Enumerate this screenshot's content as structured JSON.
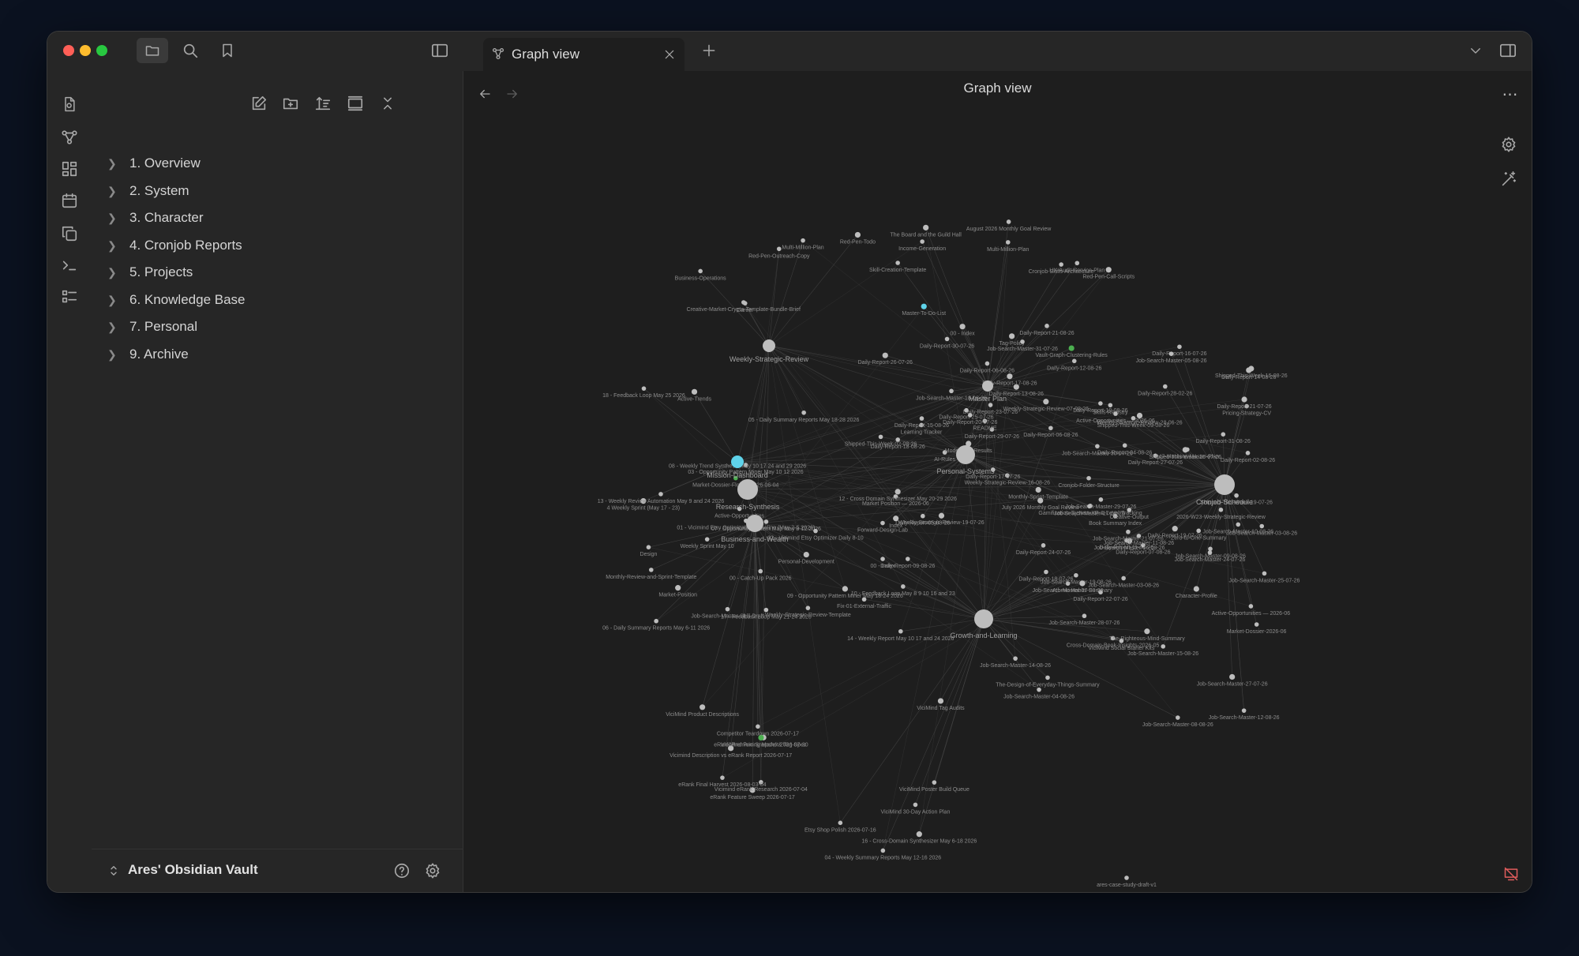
{
  "window": {
    "tab_title": "Graph view",
    "graph_title": "Graph view",
    "traffic_lights": [
      "#ff5f57",
      "#febc2e",
      "#28c840"
    ]
  },
  "sidebar": {
    "items": [
      {
        "label": "1. Overview"
      },
      {
        "label": "2. System"
      },
      {
        "label": "3. Character"
      },
      {
        "label": "4. Cronjob Reports"
      },
      {
        "label": "5. Projects"
      },
      {
        "label": "6. Knowledge Base"
      },
      {
        "label": "7. Personal"
      },
      {
        "label": "9. Archive"
      }
    ],
    "vault_name": "Ares' Obsidian Vault"
  },
  "graph": {
    "colors": {
      "node": "#bdbdbd",
      "link": "#4a4a4a",
      "highlight": "#5fd3ea",
      "attachment": "#4caf50",
      "label": "#8c8c8c"
    },
    "hubs": [
      {
        "label": "Personal-Systems"
      },
      {
        "label": "Research-Synthesis"
      },
      {
        "label": "Business-and-Wealth"
      },
      {
        "label": "Growth-and-Learning"
      },
      {
        "label": "Cronjob-Schedule"
      },
      {
        "label": "Weekly-Strategic-Review"
      },
      {
        "label": "Master Plan"
      },
      {
        "label": "Mission-Dashboard"
      }
    ],
    "labels": [
      "Business-Operations",
      "Multi-Million-Plan",
      "Red-Pen-Todo",
      "Red-Pen-Call-Scripts",
      "Income-Generation",
      "Career",
      "UX-Audit-Service-Plan",
      "Multi-Million-Plan",
      "Red-Pen-Outreach-Copy",
      "Creative-Market-Crypto-Template-Bundle-Brief",
      "Master-To-Do-List",
      "August 2026 Monthly Goal Review",
      "The Board and the Guild Hall",
      "Cronjob-Skills-Architecture",
      "Skill-Creation-Template",
      "00 - Index",
      "00 - Index",
      "2026-W23-Weekly-Strategic-Review",
      "Gamification-System-XP-&-Level-Tracking",
      "Skills-Registry",
      "Daily-Report-13-08-26",
      "Weekly-Strategic-Review-16-08-26",
      "Tag-Policy",
      "Daily-Report-12-08-26",
      "Weekly-Strategic-Review-07-08-26",
      "Daily-Report-30-07-26",
      "Daily-Report-02-08-26",
      "Daily-Report-09-08-26",
      "Monthly-Sprint-Template",
      "AI-Rules",
      "Shipped-This-Week-16-08-26",
      "Shipped-This-Week-09-08-26",
      "July 2026 Monthly Goal Review",
      "Weekly-Strategic-Review-19-07-26",
      "Daily-Report-16-07-26",
      "Daily-Report-26-07-26",
      "Active-Opportunities — 2026-06",
      "Model-Test-Results",
      "Vault-Graph-Clustering-Rules",
      "Pricing-Strategy-CV",
      "Daily-Report-28-02-26",
      "Daily-Report-11-08-26",
      "Daily-Report-06-08-26",
      "Daily-Report-31-08-26",
      "Daily-Report-21-07-26",
      "Daily-Report-19-07-26",
      "Daily-Report-27-07-26",
      "247-Machine-Master-Plan",
      "Daily-Report-23-07-26",
      "Daily-Report-29-07-26",
      "Cronjob-Folder-Structure",
      "Daily-Report-18-08-26",
      "Daily-Report-21-08-26",
      "Weekly-Strategic-Review-28-06-26",
      "Daily-Report-24-07-26",
      "Learning Tracker",
      "README",
      "Daily-Report-25-07-26",
      "Daily-Report-07-08-26",
      "Shipped-This-Week-02-08-26",
      "Shipped-This-Week-26-07-26",
      "Daily-Report-15-08-26",
      "Daily-Report-05-08-26",
      "Job-Search-Master-31-07-26",
      "Daily-Report-10-08-26",
      "Daily-Report-20-07-26",
      "Daily-Report-17-07-26",
      "Job-Search-Master-18-08-26",
      "Daily-Report-14-08-26",
      "Daily-Report-04-08-26",
      "Job-Search-Master-05-08-26",
      "Daily-Report-17-08-26",
      "Daily-Report-06-08-26",
      "Shipped-This-Week-19-07-26",
      "Job-Search-Master-30-07-26",
      "Job-Search-Master-03-08-26",
      "Job-Search-Master-07-08-26",
      "Daily-Report-22-07-26",
      "Job-Search-Master-19-08-26",
      "Job-Search-Master-14-08-26",
      "Job-Search-Master-29-07-26",
      "Job-Search-Master-28-07-26",
      "Job-Search-Master-04-08-26",
      "Job-Search-Master-12-08-26",
      "Job-Search-Master-09-08-26",
      "Job-Search-Master-16-08-26",
      "Job-Search-Master-27-07-26",
      "Job-Search-Master-25-07-26",
      "Job-Search-Master-15-08-26",
      "Job-Search-Master-10-08-26",
      "Job-Search-Master-08-08-26",
      "Job-Search-Master-03-08-26",
      "Job-Search-Master-17-08-26",
      "Job-Search-Master-11-08-26",
      "Job-Search-Master-21-07-26",
      "Job-Search-Master-24-07-26",
      "Daily-Report-18-07-26",
      "Character-Profile",
      "Market-Dossier-2026-06",
      "Cross-Domain-Book-Insights-2026-05",
      "Active-Opportunities — 2026-06",
      "Book Summary Index",
      "Zero-to-One-Summary",
      "The-Righteous-Mind-Summary",
      "Atomic-Habits-Summary",
      "The-Design-of-Everyday-Things-Summary",
      "ViciMind Social Starter Kits",
      "Creative-Output",
      "Personal-Development",
      "Market-Position",
      "Active-Trends",
      "00 - Catch-Up Pack 2026",
      "Index",
      "Design",
      "Active-Opportunities",
      "Market-Dossier-Florida-2026-06-04",
      "Fix-01-External-Traffic",
      "Forward-Design-Lab",
      "Monthly-Review-and-Sprint-Template",
      "Weekly Sprint May 10",
      "4 Weekly Sprint (May 17 - 23)",
      "Weekly-Strategic-Review-Template",
      "Job-Search-Master-Skill-Draft",
      "Market Position — 2026-06",
      "17 - Feedback Loop May 21-24 2026",
      "18 - Feedback Loop May 25 2026",
      "07 - Opportunity Pattern Map May 8-12 2026",
      "01 - Vicimind Etsy Optimization Baseline (May 2-5 2026)",
      "02 - Vicimind Etsy Optimizer Daily 8-10",
      "05 - Daily Summary Reports May 18-28 2026",
      "09 - Opportunity Pattern Miner May 18-24 2026",
      "12 - Cross Domain Synthesizer May 20-29 2026",
      "13 - Weekly Review Automation May 9 and 24 2026",
      "14 - Weekly Report May 10 17 and 24 2026",
      "03 - Opportunity Pattern Miner May 10 12 2026",
      "10 - Feedback Loop May 8 9 10 16 and 23",
      "08 - Weekly Trend Synthesis May 10 17 24 and 29 2026",
      "06 - Daily Summary Reports May 6-11 2026",
      "04 - Weekly Summary Reports May 12-16 2026",
      "16 - Cross-Domain Synthesizer May 6-18 2026",
      "Vicimind Description vs eRank Report 2026-07-17",
      "ViciMind Product Descriptions",
      "ViciMind Pricing Model & Tag Spec",
      "ViciMind 30-Day Action Plan",
      "eRank Premium Snapshot 2026-07-30",
      "ViciMind Poster Build Queue",
      "Etsy Shop Polish 2026-07-16",
      "ViciMind Tag Audits",
      "eRank Feature Sweep 2026-07-17",
      "Competitor Teardown 2026-07-17",
      "Vicimind eRank Research 2026-07-04",
      "eRank Final Harvest 2026-08-03-04",
      "ares-case-study-draft-v1"
    ]
  }
}
